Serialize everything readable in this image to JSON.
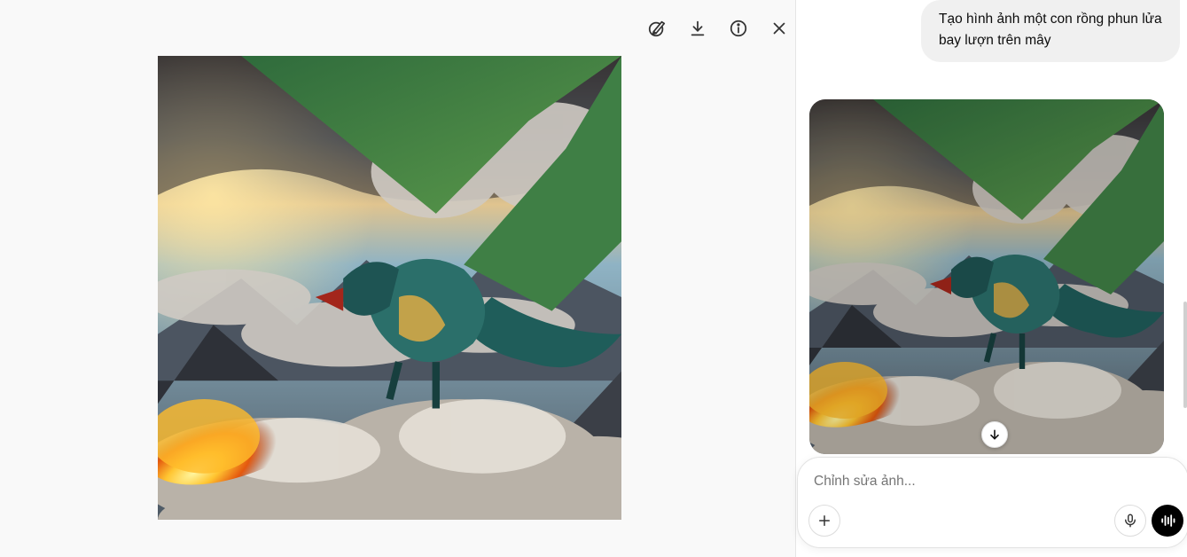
{
  "viewer": {
    "toolbar": [
      {
        "icon": "edit-image-icon"
      },
      {
        "icon": "download-icon"
      },
      {
        "icon": "info-icon"
      },
      {
        "icon": "close-icon"
      }
    ],
    "image": {
      "subject": "dragon-breathing-fire-above-clouds"
    }
  },
  "chat": {
    "user_message": "Tạo hình ảnh một con rồng phun lửa bay lượn trên mây",
    "generated_image": {
      "subject": "dragon-breathing-fire-above-clouds"
    },
    "scroll_down_icon": "arrow-down-icon",
    "composer": {
      "placeholder": "Chỉnh sửa ảnh...",
      "plus_icon": "plus-icon",
      "mic_icon": "microphone-icon",
      "voice_icon": "voice-waveform-icon"
    }
  },
  "colors": {
    "viewer_bg": "#f9f9f9",
    "bubble_bg": "#f0f0f0",
    "voice_button_bg": "#000000"
  }
}
